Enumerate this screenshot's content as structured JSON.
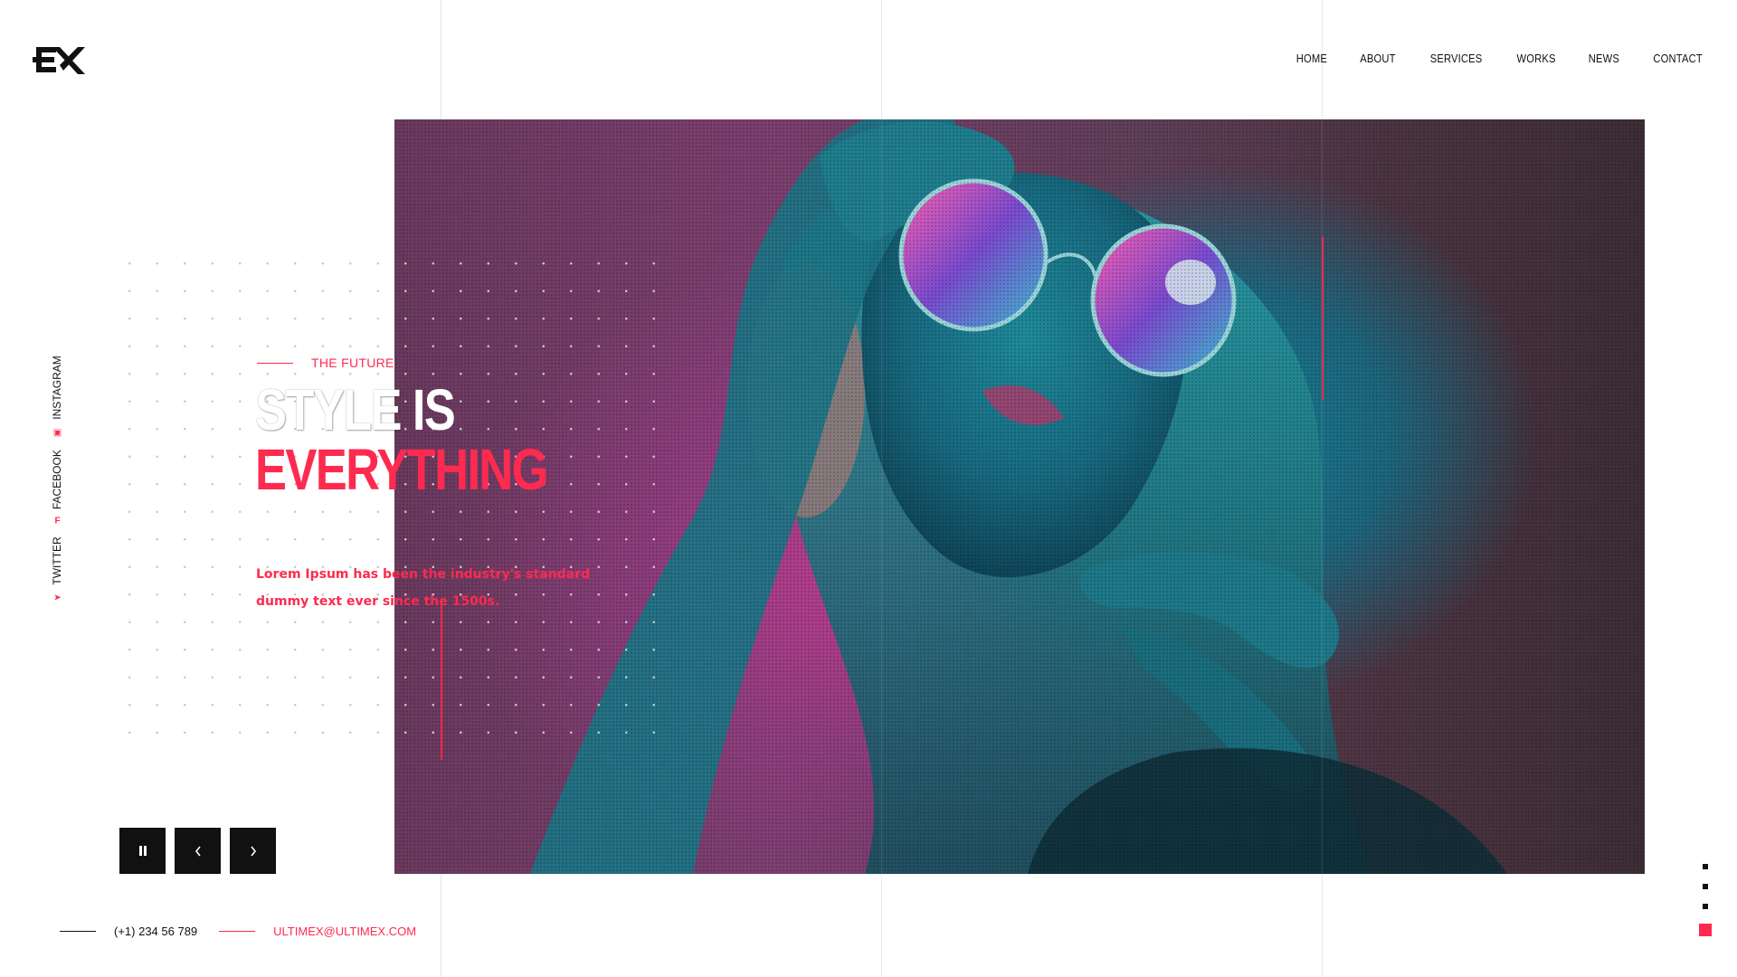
{
  "brand": {
    "logo_text": "EX",
    "accent_color": "#ff2a4f"
  },
  "nav": {
    "items": [
      {
        "label": "HOME"
      },
      {
        "label": "ABOUT"
      },
      {
        "label": "SERVICES"
      },
      {
        "label": "WORKS"
      },
      {
        "label": "NEWS"
      },
      {
        "label": "CONTACT"
      }
    ]
  },
  "social": {
    "items": [
      {
        "label": "TWITTER",
        "icon": "twitter-icon"
      },
      {
        "label": "FACEBOOK",
        "icon": "facebook-icon"
      },
      {
        "label": "INSTAGRAM",
        "icon": "instagram-icon"
      }
    ]
  },
  "hero": {
    "eyebrow": "THE FUTURE",
    "headline_word1": "STYLE",
    "headline_word2": "IS",
    "headline_line2": "EVERYTHING",
    "description_line1": "Lorem Ipsum has been the industry's standard",
    "description_line2": "dummy text ever since the 1500s.",
    "image_icon": "portrait-photo"
  },
  "controls": {
    "pause_icon": "pause-icon",
    "prev_icon": "chevron-left-icon",
    "next_icon": "chevron-right-icon"
  },
  "contacts": {
    "phone": "(+1) 234 56 789",
    "email": "ULTIMEX@ULTIMEX.COM"
  },
  "pager": {
    "total": 4,
    "active_index": 3
  }
}
